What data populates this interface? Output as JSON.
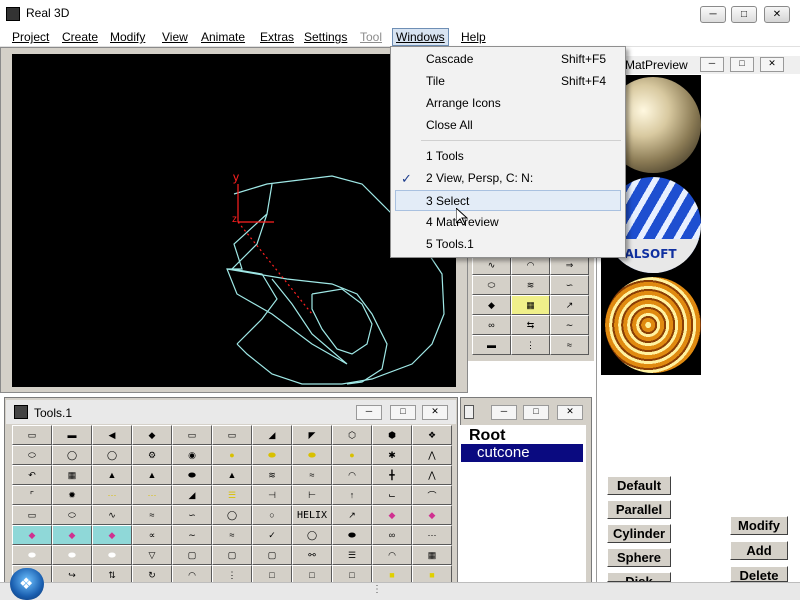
{
  "window": {
    "title": "Real 3D",
    "icon": "app-icon"
  },
  "caption_buttons": {
    "minimize": "minimize-icon",
    "maximize": "maximize-icon",
    "close": "close-icon"
  },
  "menubar": {
    "items": [
      {
        "label": "Project",
        "state": "normal"
      },
      {
        "label": "Create",
        "state": "normal"
      },
      {
        "label": "Modify",
        "state": "normal"
      },
      {
        "label": "View",
        "state": "normal"
      },
      {
        "label": "Animate",
        "state": "normal"
      },
      {
        "label": "Extras",
        "state": "normal"
      },
      {
        "label": "Settings",
        "state": "normal"
      },
      {
        "label": "Tool",
        "state": "disabled"
      },
      {
        "label": "Windows",
        "state": "active"
      },
      {
        "label": "Help",
        "state": "normal"
      }
    ]
  },
  "windows_menu": {
    "items": [
      {
        "label": "Cascade",
        "shortcut": "Shift+F5"
      },
      {
        "label": "Tile",
        "shortcut": "Shift+F4"
      },
      {
        "label": "Arrange Icons",
        "shortcut": ""
      },
      {
        "label": "Close All",
        "shortcut": ""
      },
      {
        "label": "1 Tools",
        "shortcut": ""
      },
      {
        "label": "2 View, Persp, C: N:",
        "shortcut": "",
        "checked": true
      },
      {
        "label": "3 Select",
        "shortcut": "",
        "highlighted": true
      },
      {
        "label": "4 MatPreview",
        "shortcut": ""
      },
      {
        "label": "5 Tools.1",
        "shortcut": ""
      }
    ]
  },
  "viewport": {
    "axis_y": "y",
    "axis_z": "z",
    "background": "#000000",
    "wire_color": "#9fe8e6",
    "axis_color": "#ff2020"
  },
  "matpreview": {
    "title": "MatPreview",
    "thumbnails": [
      "marble-sphere",
      "realsoft-logo-sphere",
      "wood-sphere"
    ],
    "logo_text": "REALSOFT"
  },
  "tools1": {
    "title": "Tools.1",
    "text_buttons": [
      "HELIX"
    ]
  },
  "hierarchy": {
    "root": "Root",
    "selected_item": "cutcone"
  },
  "material_buttons": [
    "Default",
    "Parallel",
    "Cylinder",
    "Sphere",
    "Disk"
  ],
  "edit_buttons": [
    "Modify",
    "Add",
    "Delete"
  ],
  "colors": {
    "face": "#d4d0c8",
    "selection": "#0a0a80",
    "menu_active": "#d8e4f2"
  }
}
